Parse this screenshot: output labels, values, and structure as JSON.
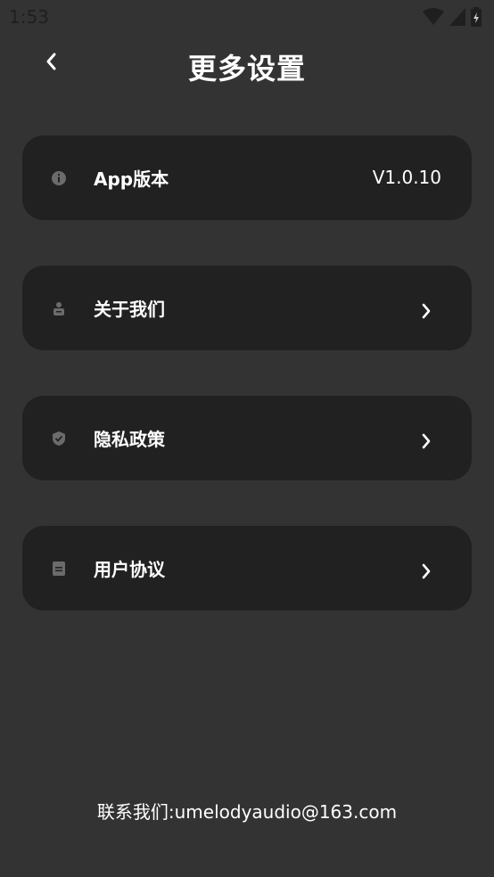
{
  "status_bar": {
    "time": "1:53",
    "icons": [
      "wifi-icon",
      "cell-signal-icon",
      "battery-icon"
    ]
  },
  "header": {
    "back_icon": "chevron-left-icon",
    "title": "更多设置"
  },
  "items": [
    {
      "icon": "info-icon",
      "label": "App版本",
      "value": "V1.0.10",
      "chevron": false
    },
    {
      "icon": "person-icon",
      "label": "关于我们",
      "value": "",
      "chevron": true
    },
    {
      "icon": "shield-icon",
      "label": "隐私政策",
      "value": "",
      "chevron": true
    },
    {
      "icon": "document-icon",
      "label": "用户协议",
      "value": "",
      "chevron": true
    }
  ],
  "contact": "联系我们:umelodyaudio@163.com",
  "colors": {
    "background": "#333333",
    "card": "#212121",
    "text": "#ffffff",
    "icon": "#6b6b6b",
    "status_text": "#1f1f1f"
  }
}
